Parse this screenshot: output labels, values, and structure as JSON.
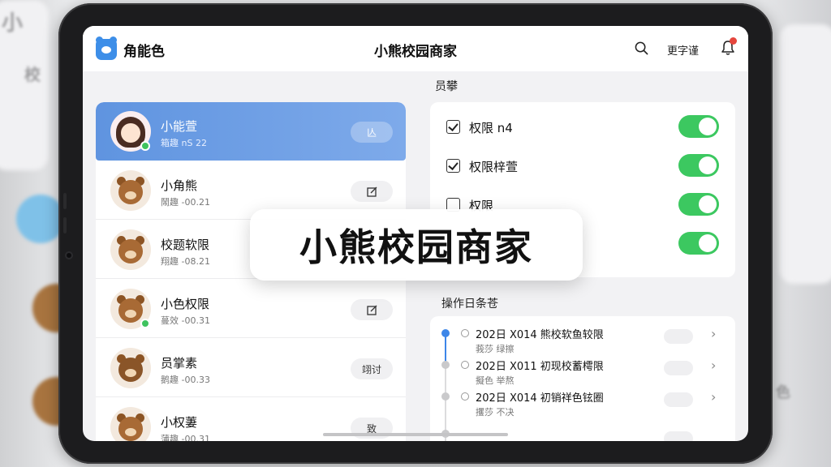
{
  "header": {
    "app_name": "角能色",
    "title": "小熊校园商家",
    "link": "更字谨"
  },
  "users": [
    {
      "name": "小能萱",
      "sub": "箱趣 nS 22",
      "action": "亾",
      "active": true,
      "avatar": "girl",
      "online": true
    },
    {
      "name": "小角熊",
      "sub": "鬧趣 -00.21",
      "action_icon": "edit-icon",
      "avatar": "bear"
    },
    {
      "name": "校题软限",
      "sub": "翔趣 -08.21",
      "avatar": "bear"
    },
    {
      "name": "小色权限",
      "sub": "蔓效 -00.31",
      "action_icon": "edit-icon",
      "avatar": "bear",
      "online": true
    },
    {
      "name": "员掌素",
      "sub": "鹅趣 -00.33",
      "action": "翊讨",
      "avatar": "bear"
    },
    {
      "name": "小权萋",
      "sub": "蒲趣 -00.31",
      "action": "致",
      "avatar": "bear"
    }
  ],
  "permissions": {
    "section_label": "员攀",
    "items": [
      {
        "label": "权限 n4",
        "checked": true,
        "on": true
      },
      {
        "label": "权限梓萱",
        "checked": true,
        "on": true
      },
      {
        "label": "权限",
        "checked": false,
        "on": true
      },
      {
        "label": "",
        "checked": false,
        "on": true
      }
    ]
  },
  "log": {
    "section_label": "操作日条苍",
    "entries": [
      {
        "title": "202日 X014 熊校软鱼较限",
        "sub": "莪莎 绿擦",
        "active": true
      },
      {
        "title": "202日 X011 初现校蓄樗限",
        "sub": "擬色 举熬"
      },
      {
        "title": "202日 X014 初销祥色铉圈",
        "sub": "攫莎 不决"
      }
    ]
  },
  "overlay_title": "小熊校园商家",
  "colors": {
    "accent": "#5f94e0",
    "toggle_on": "#3cc860",
    "timeline_active": "#3d86e8",
    "badge": "#e5463d"
  }
}
